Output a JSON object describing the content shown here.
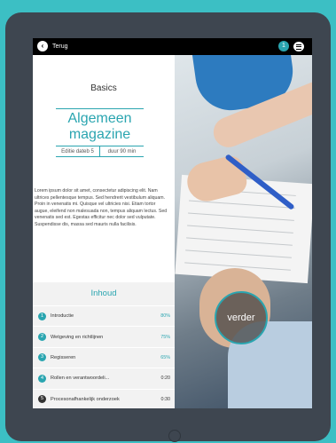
{
  "topbar": {
    "back_label": "Terug",
    "back_icon": "chevron-left-icon",
    "badge": "1",
    "menu_icon": "hamburger-icon"
  },
  "content": {
    "section": "Basics",
    "title": "Algemeen magazine",
    "edition": "Editie dateb 5",
    "duration": "duur 90 min",
    "body": "Lorem ipsum dolor sit amet, consectetur adipiscing elit. Nam ultrices pellentesque tempus. Sed hendrerit vestibulum aliquam. Proin in venenatis mi. Quisque vel ultricies nisi. Etiam tortor augue, eleifend non malesuada non, tempus aliquam lectus. Sed venenatis sed est. Egestas efficitur nec dolor sed vulputate. Suspendisse dis, massa sed mauris nulla facilisis."
  },
  "toc": {
    "title": "Inhoud",
    "items": [
      {
        "num": "1",
        "label": "Introductie",
        "value": "80%",
        "done": true
      },
      {
        "num": "2",
        "label": "Wetgeving en richtlijnen",
        "value": "75%",
        "done": true
      },
      {
        "num": "3",
        "label": "Regisseren",
        "value": "65%",
        "done": true
      },
      {
        "num": "4",
        "label": "Rollen en verantwoordeli...",
        "value": "0:20",
        "done": true
      },
      {
        "num": "5",
        "label": "Procesonafhankelijk onderzoek",
        "value": "0:30",
        "done": false
      }
    ]
  },
  "cta": {
    "label": "verder"
  },
  "colors": {
    "accent": "#2aa5b0",
    "background": "#3cbfc4",
    "device": "#3e4650"
  }
}
